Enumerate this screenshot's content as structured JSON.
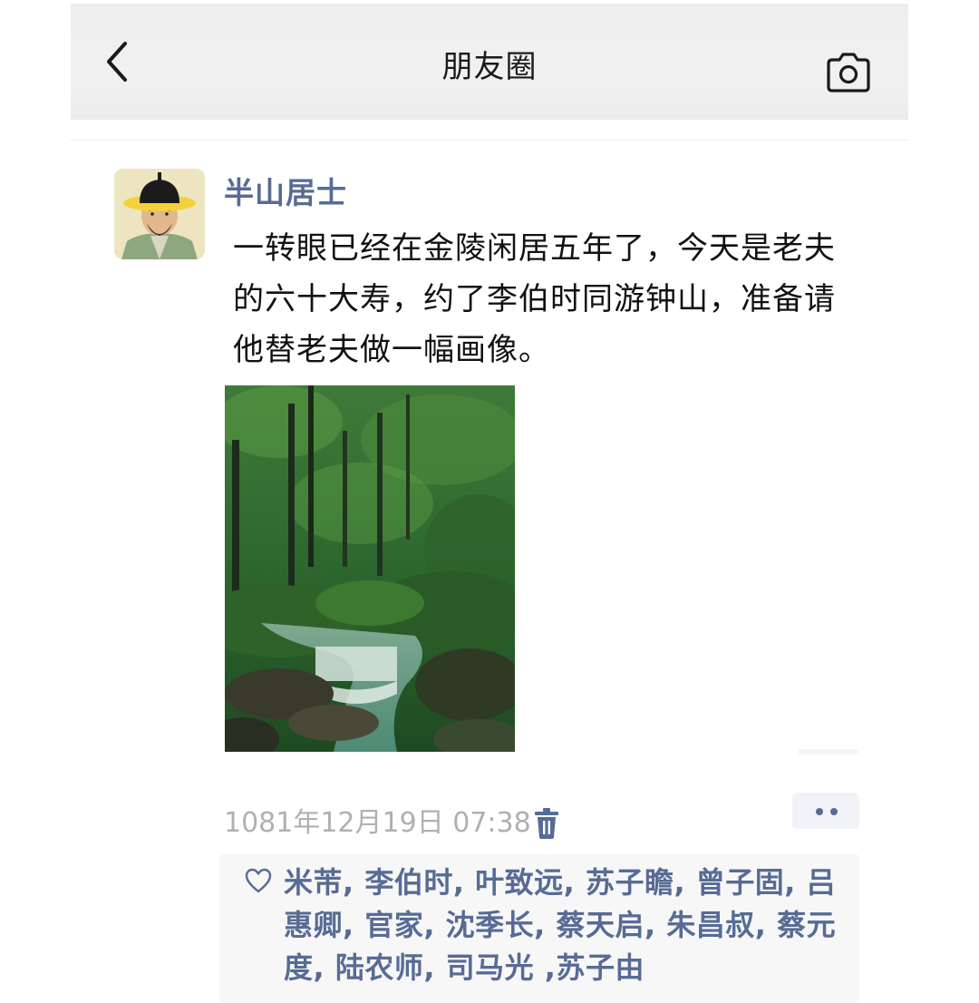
{
  "nav": {
    "title": "朋友圈",
    "back_icon": "chevron-left-icon",
    "camera_icon": "camera-icon"
  },
  "post": {
    "author": "半山居士",
    "text": "一转眼已经在金陵闲居五年了，今天是老夫的六十大寿，约了李伯时同游钟山，准备请他替老夫做一幅画像。",
    "photo_subject": "forest-stream-photo",
    "timestamp": "1081年12月19日 07:38",
    "delete_icon": "trash-icon",
    "more_icon": "more-dots-icon"
  },
  "likes": {
    "icon": "heart-outline-icon",
    "names": [
      "米芾",
      "李伯时",
      "叶致远",
      "苏子瞻",
      "曾子固",
      "吕惠卿",
      "官家",
      "沈季长",
      "蔡天启",
      "朱昌叔",
      "蔡元度",
      "陆农师",
      "司马光",
      "苏子由"
    ],
    "separator": ","
  },
  "colors": {
    "link_blue": "#576b95",
    "nav_bg": "#ededed",
    "likes_bg": "#f7f7f7",
    "timestamp_gray": "#b0b0b0"
  }
}
